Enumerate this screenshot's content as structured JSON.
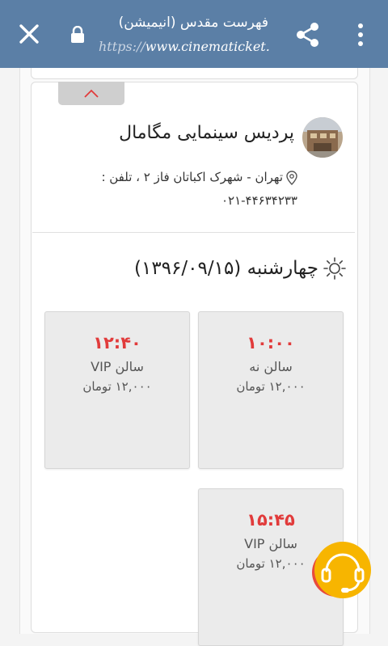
{
  "browser": {
    "title": "فهرست مقدس (انیمیشن)",
    "url_scheme": "https://",
    "url_host": "www.cinematicket."
  },
  "cinema": {
    "name": "پردیس سینمایی مگامال",
    "address": "تهران - شهرک اکباتان فاز ۲ ، تلفن :",
    "phone": "۰۲۱-۴۴۶۳۴۲۳۳"
  },
  "day": {
    "label": "چهارشنبه (۱۳۹۶/۰۹/۱۵)"
  },
  "sessions": [
    {
      "time": "۱۰:۰۰",
      "hall": "سالن نه",
      "price": "۱۲,۰۰۰ تومان"
    },
    {
      "time": "۱۲:۴۰",
      "hall": "سالن VIP",
      "price": "۱۲,۰۰۰ تومان"
    },
    {
      "time": "۱۵:۴۵",
      "hall": "سالن VIP",
      "price": "۱۲,۰۰۰ تومان"
    }
  ],
  "colors": {
    "toolbar": "#5b7fa6",
    "time_accent": "#e13b3b",
    "support_button": "#f7b500"
  }
}
